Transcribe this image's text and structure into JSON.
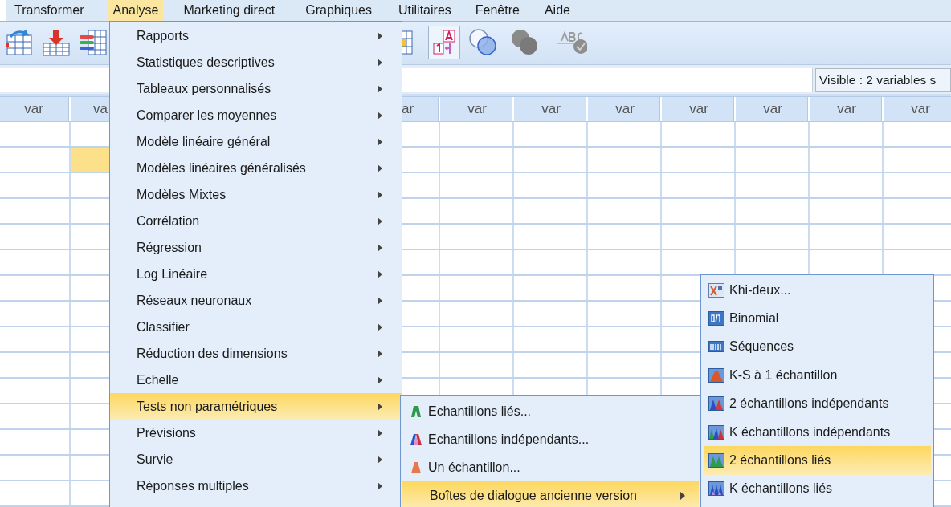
{
  "menu_bar": [
    {
      "label": "Transformer",
      "selected": false
    },
    {
      "label": "Analyse",
      "selected": true
    },
    {
      "label": "Marketing direct",
      "selected": false
    },
    {
      "label": "Graphiques",
      "selected": false
    },
    {
      "label": "Utilitaires",
      "selected": false
    },
    {
      "label": "Fenêtre",
      "selected": false
    },
    {
      "label": "Aide",
      "selected": false
    }
  ],
  "info_bar": {
    "status": "Visible : 2 variables s"
  },
  "grid": {
    "columns": [
      {
        "label": "var",
        "selected": false
      },
      {
        "label": "va",
        "selected": true
      },
      {},
      {},
      {},
      {
        "label": "ar",
        "selected": false
      },
      {
        "label": "var",
        "selected": false
      },
      {
        "label": "var",
        "selected": false
      },
      {
        "label": "var",
        "selected": false
      },
      {
        "label": "var",
        "selected": false
      },
      {
        "label": "var",
        "selected": false
      },
      {
        "label": "var",
        "selected": false
      },
      {
        "label": "var",
        "selected": false
      }
    ],
    "rows": [
      {
        "selected": false
      },
      {
        "selected": true
      },
      {
        "selected": false
      },
      {
        "selected": false
      },
      {
        "selected": false
      },
      {
        "selected": false
      },
      {
        "selected": false
      },
      {
        "selected": false
      },
      {
        "selected": false
      },
      {
        "selected": false
      },
      {
        "selected": false
      },
      {
        "selected": false
      },
      {
        "selected": false
      },
      {
        "selected": false
      },
      {
        "selected": false
      }
    ]
  },
  "analyse_menu": {
    "items": [
      {
        "label": "Rapports",
        "submenu": true,
        "selected": false
      },
      {
        "label": "Statistiques descriptives",
        "submenu": true,
        "selected": false
      },
      {
        "label": "Tableaux personnalisés",
        "submenu": true,
        "selected": false
      },
      {
        "label": "Comparer les moyennes",
        "submenu": true,
        "selected": false
      },
      {
        "label": "Modèle linéaire général",
        "submenu": true,
        "selected": false
      },
      {
        "label": "Modèles linéaires généralisés",
        "submenu": true,
        "selected": false
      },
      {
        "label": "Modèles Mixtes",
        "submenu": true,
        "selected": false
      },
      {
        "label": "Corrélation",
        "submenu": true,
        "selected": false
      },
      {
        "label": "Régression",
        "submenu": true,
        "selected": false
      },
      {
        "label": "Log Linéaire",
        "submenu": true,
        "selected": false
      },
      {
        "label": "Réseaux neuronaux",
        "submenu": true,
        "selected": false
      },
      {
        "label": "Classifier",
        "submenu": true,
        "selected": false
      },
      {
        "label": "Réduction des dimensions",
        "submenu": true,
        "selected": false
      },
      {
        "label": "Echelle",
        "submenu": true,
        "selected": false
      },
      {
        "label": "Tests non paramétriques",
        "submenu": true,
        "selected": true
      },
      {
        "label": "Prévisions",
        "submenu": true,
        "selected": false
      },
      {
        "label": "Survie",
        "submenu": true,
        "selected": false
      },
      {
        "label": "Réponses multiples",
        "submenu": true,
        "selected": false
      }
    ]
  },
  "nonparametric_menu": {
    "items": [
      {
        "label": "Echantillons liés...",
        "kind": "related",
        "submenu": false,
        "selected": false
      },
      {
        "label": "Echantillons indépendants...",
        "kind": "independent",
        "submenu": false,
        "selected": false
      },
      {
        "label": "Un échantillon...",
        "kind": "onesample",
        "submenu": false,
        "selected": false
      },
      {
        "label": "Boîtes de dialogue ancienne version",
        "kind": "plain",
        "submenu": true,
        "selected": true
      }
    ]
  },
  "legacy_menu": {
    "items": [
      {
        "label": "Khi-deux...",
        "kind": "chisquare",
        "selected": false
      },
      {
        "label": "Binomial",
        "kind": "binomial",
        "selected": false
      },
      {
        "label": "Séquences",
        "kind": "runs",
        "selected": false
      },
      {
        "label": "K-S à 1 échantillon",
        "kind": "ks",
        "selected": false
      },
      {
        "label": "2 échantillons indépendants",
        "kind": "twoindependent",
        "selected": false
      },
      {
        "label": "K échantillons indépendants",
        "kind": "kindependent",
        "selected": false
      },
      {
        "label": "2 échantillons liés",
        "kind": "tworelated",
        "selected": true
      },
      {
        "label": "K échantillons liés",
        "kind": "krelated",
        "selected": false
      }
    ]
  }
}
